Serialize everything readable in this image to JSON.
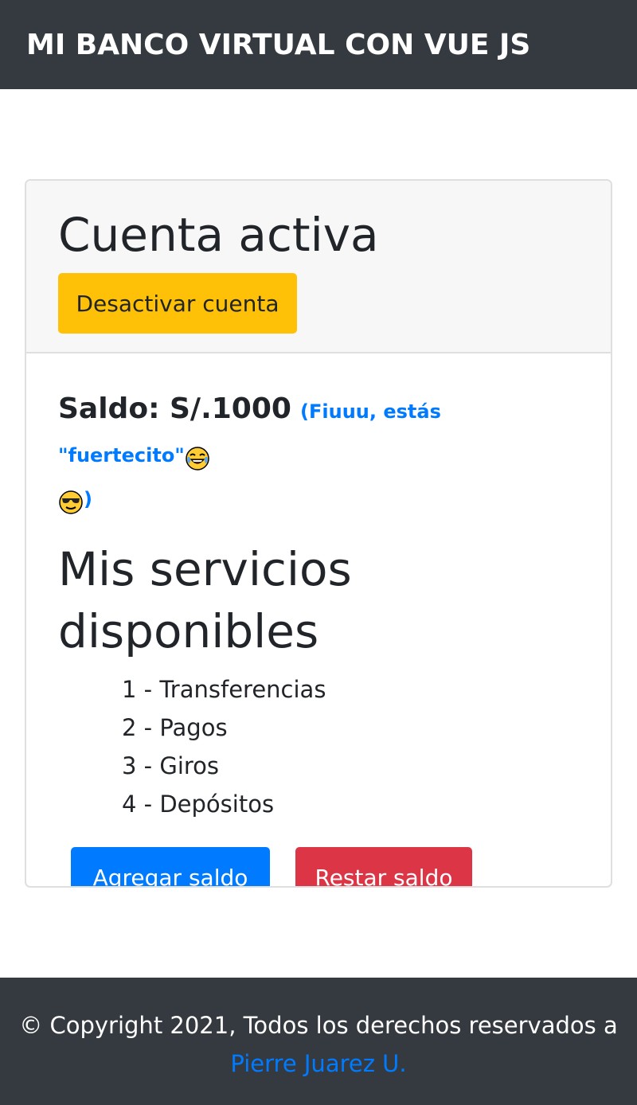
{
  "navbar": {
    "brand": "MI BANCO VIRTUAL CON VUE JS"
  },
  "account": {
    "status_title": "Cuenta activa",
    "deactivate_label": "Desactivar cuenta",
    "balance_text": "Saldo: S/.1000",
    "balance_note": "(Fiuuu, estás \"fuertecito\"",
    "balance_note_end": ")",
    "emoji_1": "face-with-tears-of-joy-icon",
    "emoji_2": "smiling-face-with-sunglasses-icon"
  },
  "services": {
    "title": "Mis servicios disponibles",
    "items": [
      "1 - Transferencias",
      "2 - Pagos",
      "3 - Giros",
      "4 - Depósitos"
    ]
  },
  "actions": {
    "add_label": "Agregar saldo",
    "subtract_label": "Restar saldo"
  },
  "footer": {
    "text": "© Copyright 2021, Todos los derechos reservados a",
    "author": "Pierre Juarez U."
  },
  "colors": {
    "navbar_bg": "#343a40",
    "warning": "#ffc107",
    "primary": "#007bff",
    "danger": "#dc3545"
  }
}
